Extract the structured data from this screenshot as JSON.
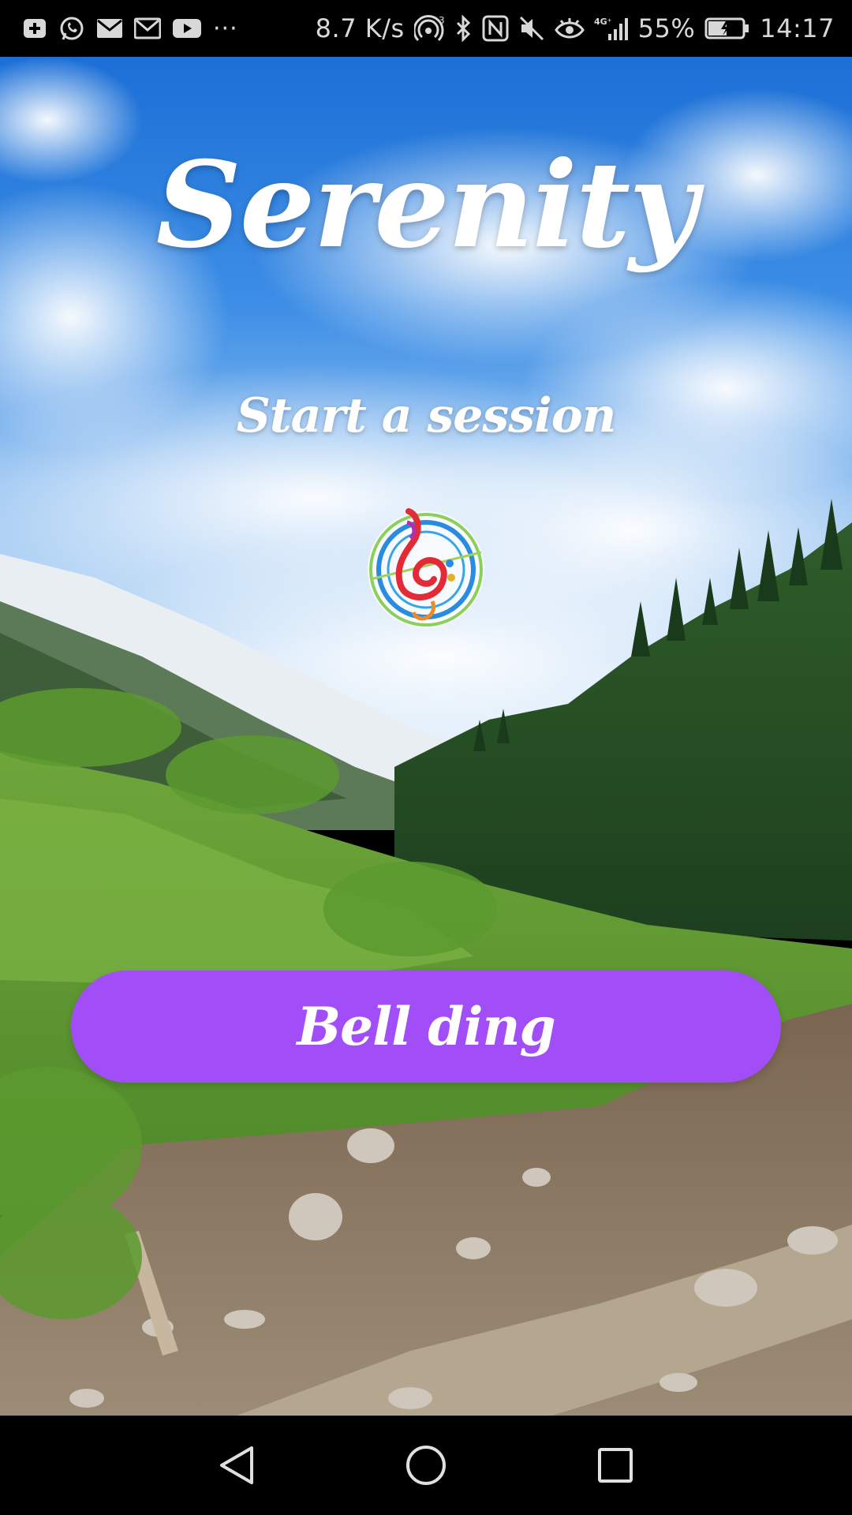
{
  "status_bar": {
    "left_icons": [
      "notification-add-icon",
      "whatsapp-icon",
      "mail-icon",
      "gmail-icon",
      "youtube-icon"
    ],
    "more_indicator": "···",
    "network_speed": "8.7 K/s",
    "right_icons": [
      "hotspot-icon",
      "bluetooth-icon",
      "nfc-icon",
      "mute-icon",
      "eye-comfort-icon",
      "signal-4g-icon"
    ],
    "battery_percent": "55%",
    "battery_level": 0.55,
    "time": "14:17"
  },
  "app": {
    "title": "Serenity",
    "subtitle": "Start a session",
    "logo_icon": "music-clef-logo-icon",
    "primary_button_label": "Bell ding",
    "button_color": "#a24ef8"
  },
  "nav_bar": {
    "buttons": [
      "back-icon",
      "home-icon",
      "recents-icon"
    ]
  }
}
